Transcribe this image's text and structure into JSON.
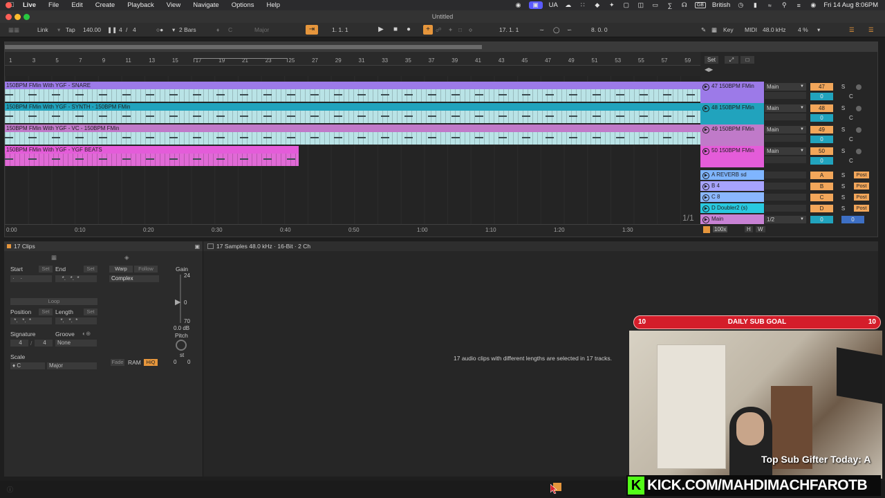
{
  "menubar": {
    "app": "Live",
    "items": [
      "File",
      "Edit",
      "Create",
      "Playback",
      "View",
      "Navigate",
      "Options",
      "Help"
    ],
    "ua": "UA",
    "keyboard": "British",
    "keyboard_badge": "GB",
    "datetime": "Fri 14 Aug  8:06PM"
  },
  "window": {
    "title": "Untitled"
  },
  "control": {
    "link": "Link",
    "tap": "Tap",
    "tempo": "140.00",
    "sig_num": "4",
    "sig_den": "4",
    "quantize": "2 Bars",
    "key": "C",
    "scale": "Major",
    "position": "1.   1.   1",
    "loop_start": "17.   1.   1",
    "loop_length": "8.   0.   0",
    "key_label": "Key",
    "midi_label": "MIDI",
    "sample_rate": "48.0 kHz",
    "cpu": "4 %"
  },
  "ruler": {
    "bars": [
      "1",
      "3",
      "5",
      "7",
      "9",
      "11",
      "13",
      "15",
      "17",
      "19",
      "21",
      "23",
      "25",
      "27",
      "29",
      "31",
      "33",
      "35",
      "37",
      "39",
      "41",
      "43",
      "45",
      "47",
      "49",
      "51",
      "53",
      "55",
      "57",
      "59"
    ],
    "set_label": "Set"
  },
  "tracks": [
    {
      "clip": "150BPM FMin With YGF - SNARE",
      "name": "47 150BPM FMin",
      "out": "Main",
      "num": "47",
      "vol": "0",
      "pan": "C",
      "color": "#9c7ae8"
    },
    {
      "clip": "150BPM FMin With YGF - SYNTH - 150BPM FMin",
      "name": "48 150BPM FMin",
      "out": "Main",
      "num": "48",
      "vol": "0",
      "pan": "C",
      "color": "#21a3bd"
    },
    {
      "clip": "150BPM FMin With YGF - VC - 150BPM FMin",
      "name": "49 150BPM FMin",
      "out": "Main",
      "num": "49",
      "vol": "0",
      "pan": "C",
      "color": "#c07ac9"
    },
    {
      "clip": "150BPM FMin With YGF - YGF BEATS",
      "name": "50 150BPM FMin",
      "out": "Main",
      "num": "50",
      "vol": "0",
      "pan": "C",
      "color": "#e45cd9"
    }
  ],
  "returns": [
    {
      "name": "A REVERB sd",
      "letter": "A",
      "post": "Post",
      "color": "#7fb5ff"
    },
    {
      "name": "B 4",
      "letter": "B",
      "post": "Post",
      "color": "#a7a3ff"
    },
    {
      "name": "C 8",
      "letter": "C",
      "post": "Post",
      "color": "#8ab7ff"
    },
    {
      "name": "D Doubler2 (s)",
      "letter": "D",
      "post": "Post",
      "color": "#28c9e0"
    }
  ],
  "main": {
    "name": "Main",
    "out": "1/2",
    "vol": "0",
    "pan": "0",
    "zoom": "100x",
    "page": "1/1"
  },
  "time_marks": [
    "0:00",
    "0:10",
    "0:20",
    "0:30",
    "0:40",
    "0:50",
    "1:00",
    "1:10",
    "1:20",
    "1:30"
  ],
  "clip": {
    "title": "17 Clips",
    "start": "Start",
    "end": "End",
    "set": "Set",
    "loop": "Loop",
    "position": "Position",
    "length": "Length",
    "signature": "Signature",
    "sig_num": "4",
    "sig_den": "4",
    "groove": "Groove",
    "groove_val": "None",
    "scale": "Scale",
    "scale_key": "C",
    "scale_mode": "Major",
    "warp": "Warp",
    "follow": "Follow",
    "warp_mode": "Complex",
    "gain": "Gain",
    "gain_max": "24",
    "gain_zero": "0",
    "gain_min": "70",
    "gain_val": "0.0 dB",
    "pitch": "Pitch",
    "st": "st",
    "fade": "Fade",
    "ram": "RAM",
    "hiq": "HiQ",
    "detune_a": "0",
    "detune_b": "0"
  },
  "sample": {
    "info": "17 Samples  48.0 kHz · 16-Bit · 2 Ch",
    "message": "17 audio clips with different lengths are selected in 17 tracks."
  },
  "overlay": {
    "goal_left": "10",
    "goal_title": "DAILY SUB GOAL",
    "goal_right": "10",
    "top_gifter": "Top Sub Gifter Today: A",
    "kick_logo": "K",
    "kick_url": "KICK.COM/MAHDIMACHFAROTB"
  }
}
